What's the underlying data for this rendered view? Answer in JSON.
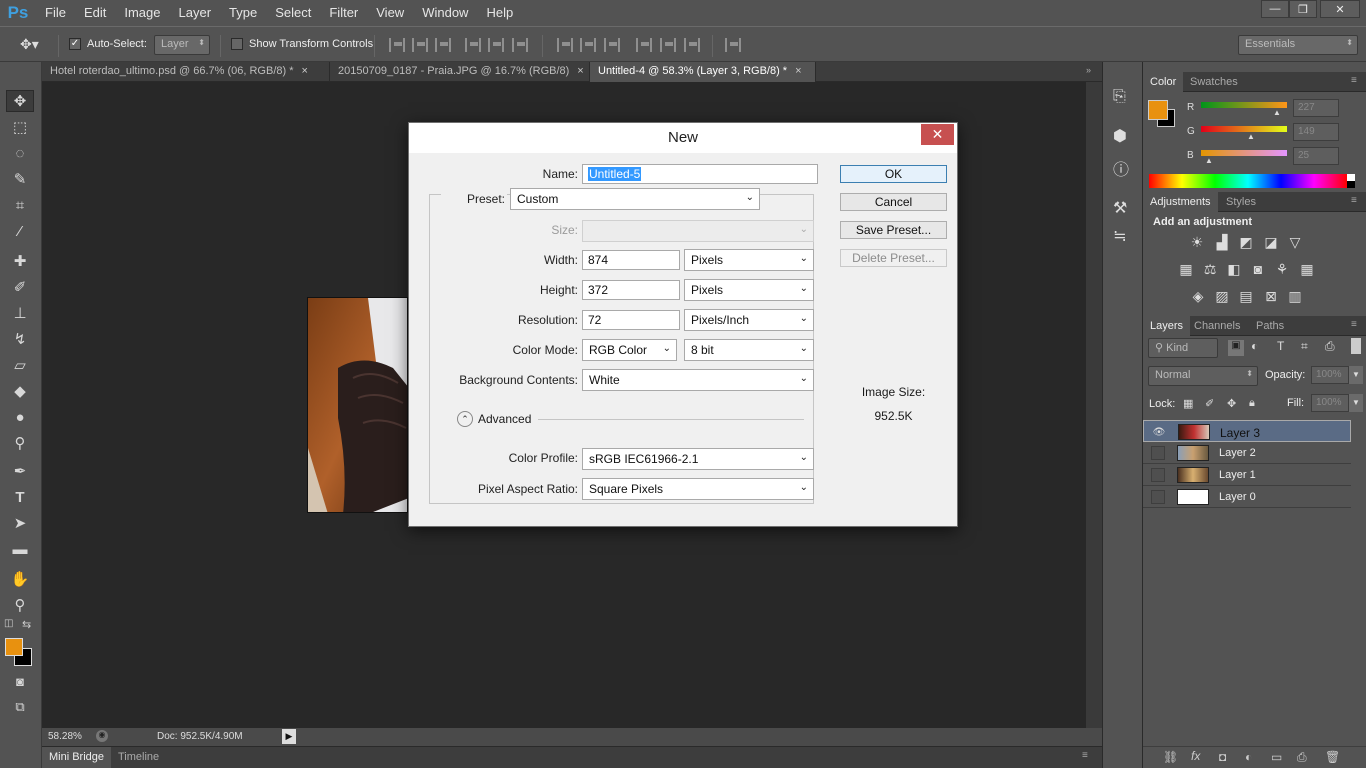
{
  "app": {
    "logo": "Ps"
  },
  "menu": [
    "File",
    "Edit",
    "Image",
    "Layer",
    "Type",
    "Select",
    "Filter",
    "View",
    "Window",
    "Help"
  ],
  "window_controls": {
    "minimize": "—",
    "restore": "❐",
    "close": "✕"
  },
  "options": {
    "auto_select_label": "Auto-Select:",
    "auto_select_value": "Layer",
    "show_transform_label": "Show Transform Controls",
    "workspace": "Essentials"
  },
  "tabs": [
    {
      "label": "Hotel roterdao_ultimo.psd @ 66.7% (06, RGB/8) *",
      "close": "×"
    },
    {
      "label": "20150709_0187 - Praia.JPG @ 16.7% (RGB/8)",
      "close": "×"
    },
    {
      "label": "Untitled-4 @ 58.3% (Layer 3, RGB/8) *",
      "close": "×"
    }
  ],
  "status": {
    "zoom": "58.28%",
    "doc": "Doc: 952.5K/4.90M"
  },
  "bottom_tabs": [
    "Mini Bridge",
    "Timeline"
  ],
  "color_panel": {
    "tabs": [
      "Color",
      "Swatches"
    ],
    "fg": "#e8910f",
    "bg": "#000000",
    "r_label": "R",
    "g_label": "G",
    "b_label": "B",
    "r": "227",
    "g": "149",
    "b": "25"
  },
  "adjustments": {
    "tabs": [
      "Adjustments",
      "Styles"
    ],
    "heading": "Add an adjustment"
  },
  "layers_panel": {
    "tabs": [
      "Layers",
      "Channels",
      "Paths"
    ],
    "kind": "Kind",
    "blend_mode": "Normal",
    "opacity_label": "Opacity:",
    "opacity": "100%",
    "lock_label": "Lock:",
    "fill_label": "Fill:",
    "fill": "100%",
    "layers": [
      {
        "name": "Layer 3",
        "selected": true,
        "visible": true
      },
      {
        "name": "Layer 2",
        "selected": false,
        "visible": false
      },
      {
        "name": "Layer 1",
        "selected": false,
        "visible": false
      },
      {
        "name": "Layer 0",
        "selected": false,
        "visible": false
      }
    ]
  },
  "dialog": {
    "title": "New",
    "close": "✕",
    "name_label": "Name:",
    "name_value": "Untitled-5",
    "preset_label": "Preset:",
    "preset_value": "Custom",
    "size_label": "Size:",
    "width_label": "Width:",
    "width_value": "874",
    "width_unit": "Pixels",
    "height_label": "Height:",
    "height_value": "372",
    "height_unit": "Pixels",
    "resolution_label": "Resolution:",
    "resolution_value": "72",
    "resolution_unit": "Pixels/Inch",
    "color_mode_label": "Color Mode:",
    "color_mode_value": "RGB Color",
    "bit_depth": "8 bit",
    "bg_label": "Background Contents:",
    "bg_value": "White",
    "advanced_label": "Advanced",
    "profile_label": "Color Profile:",
    "profile_value": "sRGB IEC61966-2.1",
    "par_label": "Pixel Aspect Ratio:",
    "par_value": "Square Pixels",
    "ok": "OK",
    "cancel": "Cancel",
    "save_preset": "Save Preset...",
    "delete_preset": "Delete Preset...",
    "image_size_label": "Image Size:",
    "image_size_value": "952.5K"
  }
}
